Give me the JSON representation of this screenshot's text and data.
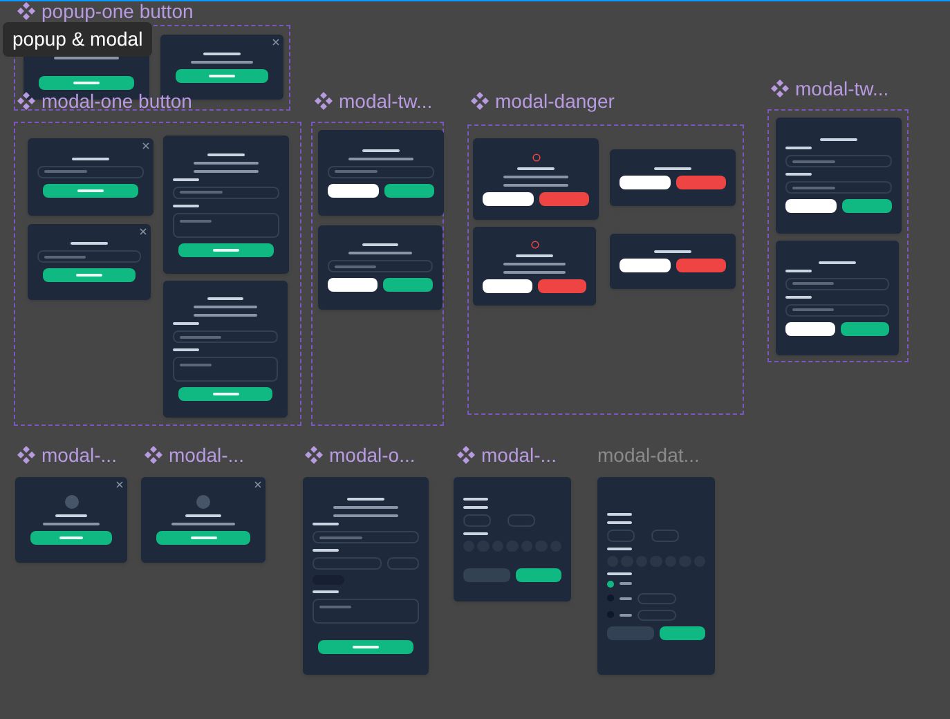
{
  "tooltip": {
    "text": "popup & modal"
  },
  "frames": [
    {
      "label": "popup-one button",
      "kind": "component"
    },
    {
      "label": "modal-one button",
      "kind": "component"
    },
    {
      "label": "modal-tw...",
      "kind": "component"
    },
    {
      "label": "modal-danger",
      "kind": "component"
    },
    {
      "label": "modal-tw...",
      "kind": "component"
    },
    {
      "label": "modal-...",
      "kind": "component"
    },
    {
      "label": "modal-...",
      "kind": "component"
    },
    {
      "label": "modal-o...",
      "kind": "component"
    },
    {
      "label": "modal-...",
      "kind": "component"
    },
    {
      "label": "modal-dat...",
      "kind": "frame"
    }
  ],
  "radios": [
    {
      "selected": true
    },
    {
      "selected": false
    },
    {
      "selected": false
    }
  ]
}
